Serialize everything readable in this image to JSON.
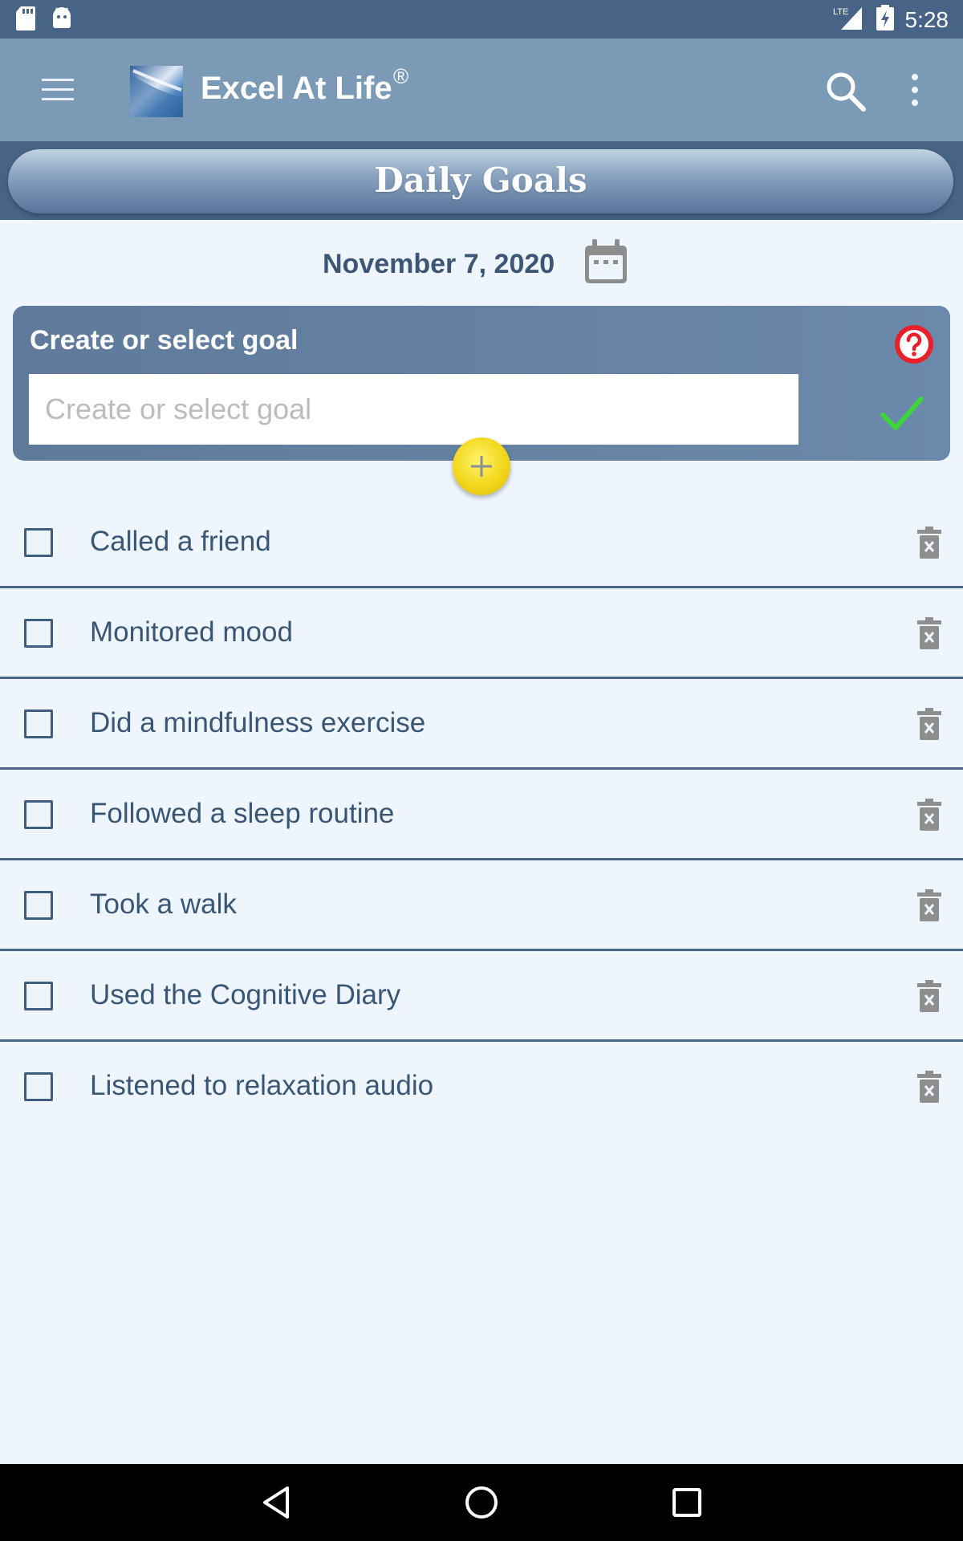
{
  "status_bar": {
    "time": "5:28",
    "network": "LTE"
  },
  "app_bar": {
    "title": "Excel At Life",
    "registered_mark": "®"
  },
  "page": {
    "title": "Daily Goals"
  },
  "date": {
    "label": "November 7, 2020"
  },
  "goal_form": {
    "heading": "Create or select goal",
    "placeholder": "Create or select goal",
    "value": ""
  },
  "goals": [
    {
      "label": "Called a friend",
      "checked": false
    },
    {
      "label": "Monitored mood",
      "checked": false
    },
    {
      "label": "Did a mindfulness exercise",
      "checked": false
    },
    {
      "label": "Followed a sleep routine",
      "checked": false
    },
    {
      "label": "Took a walk",
      "checked": false
    },
    {
      "label": "Used the Cognitive Diary",
      "checked": false
    },
    {
      "label": "Listened to relaxation audio",
      "checked": false
    }
  ],
  "icons": {
    "menu": "hamburger-menu-icon",
    "search": "search-icon",
    "overflow": "more-vert-icon",
    "calendar": "calendar-icon",
    "help": "help-icon",
    "confirm": "checkmark-icon",
    "add": "plus-icon",
    "delete": "trash-icon"
  },
  "colors": {
    "status_bar": "#476486",
    "app_bar": "#7b9ab5",
    "background": "#eef5fd",
    "accent_text": "#3a5675",
    "confirm_green": "#3fd43a",
    "help_red": "#e8202a",
    "add_button_yellow": "#f2d71c"
  }
}
